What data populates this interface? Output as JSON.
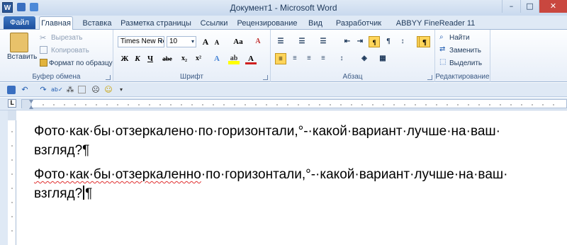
{
  "window": {
    "app_icon": "W",
    "title": "Документ1  -  Microsoft Word",
    "min": "–",
    "max": "□",
    "close": "✕"
  },
  "tabs": {
    "file": "Файл",
    "items": [
      "Главная",
      "Вставка",
      "Разметка страницы",
      "Ссылки",
      "Рецензирование",
      "Вид",
      "Разработчик",
      "ABBYY FineReader 11"
    ],
    "active": "Главная"
  },
  "ribbon": {
    "clipboard": {
      "paste": "Вставить",
      "cut": "Вырезать",
      "copy": "Копировать",
      "format_painter": "Формат по образцу",
      "label": "Буфер обмена"
    },
    "font": {
      "family": "Times New Rc",
      "size": "10",
      "grow": "A",
      "shrink": "A",
      "case": "Aa",
      "bold": "Ж",
      "italic": "К",
      "underline": "Ч",
      "strike": "abe",
      "sub": "x₂",
      "sup": "x²",
      "color_a": "A",
      "label": "Шрифт"
    },
    "paragraph": {
      "label": "Абзац",
      "show_marks": "¶"
    },
    "styles": {
      "show": "¶"
    },
    "editing": {
      "find": "Найти",
      "replace": "Заменить",
      "select": "Выделить",
      "label": "Редактирование"
    }
  },
  "qat_icons": [
    "save-icon",
    "undo-icon",
    "redo-icon",
    "spelling-icon",
    "network-icon",
    "blank-icon",
    "sad-icon",
    "smile-icon",
    "customize-icon"
  ],
  "ruler": {
    "corner": "L"
  },
  "document": {
    "para1_line1": "Фото·как·бы·отзеркалено·по·горизонтали,°-·какой·вариант·лучше·на·ваш·",
    "para1_line2": "взгляд?¶",
    "para2_line1_a": "Фото·как·бы·отзеркаленно",
    "para2_line1_b": "·по·горизонтали,°-·какой·вариант·лучше·на·ваш·",
    "para2_line2_a": "взгляд?",
    "para2_line2_b": "¶"
  }
}
